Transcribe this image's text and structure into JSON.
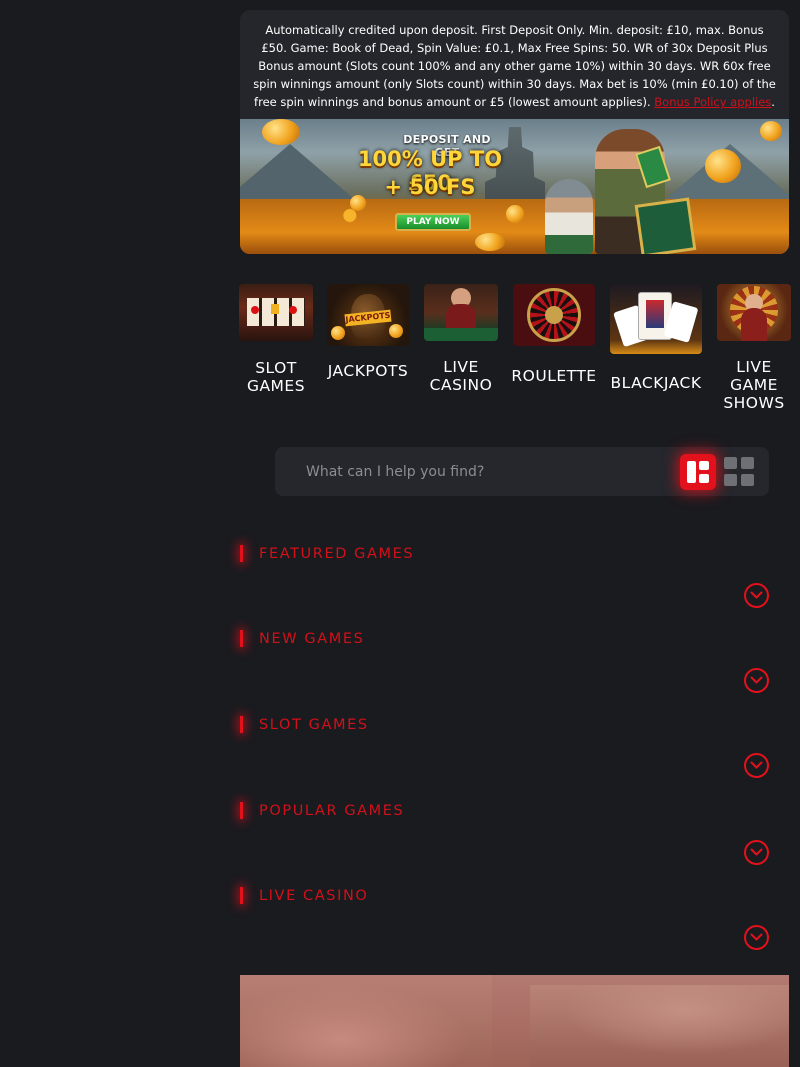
{
  "promo": {
    "terms": "Automatically credited upon deposit. First Deposit Only. Min. deposit: £10, max. Bonus £50. Game: Book of Dead, Spin Value: £0.1, Max Free Spins: 50. WR of 30x Deposit Plus Bonus amount (Slots count 100% and any other game 10%) within 30 days. WR 60x free spin winnings amount (only Slots count) within 30 days. Max bet is 10% (min £0.10) of the free spin winnings and bonus amount or £5 (lowest amount applies).",
    "policy_link": "Bonus Policy applies",
    "policy_suffix": ".",
    "banner": {
      "line1": "DEPOSIT AND GET",
      "line2": "100% UP TO £50",
      "line3": "+ 50 FS",
      "cta": "PLAY NOW"
    }
  },
  "categories": [
    {
      "label": "SLOT GAMES",
      "icon": "slot-machine-icon"
    },
    {
      "label": "JACKPOTS",
      "icon": "jackpot-bag-icon"
    },
    {
      "label": "LIVE CASINO",
      "icon": "live-dealer-icon"
    },
    {
      "label": "ROULETTE",
      "icon": "roulette-wheel-icon"
    },
    {
      "label": "BLACKJACK",
      "icon": "playing-cards-icon"
    },
    {
      "label": "LIVE GAME SHOWS",
      "icon": "game-show-wheel-icon"
    }
  ],
  "search": {
    "placeholder": "What can I help you find?",
    "view_list_icon": "list-view-icon",
    "view_grid_icon": "grid-view-icon"
  },
  "sections": [
    {
      "title": "FEATURED GAMES"
    },
    {
      "title": "NEW GAMES"
    },
    {
      "title": "SLOT GAMES"
    },
    {
      "title": "POPULAR GAMES"
    },
    {
      "title": "LIVE CASINO"
    }
  ],
  "colors": {
    "background": "#1a1b1f",
    "panel": "#24262c",
    "accent_red": "#e3111b",
    "section_title": "#d2101a",
    "banner_gold": "#ffd63a"
  }
}
